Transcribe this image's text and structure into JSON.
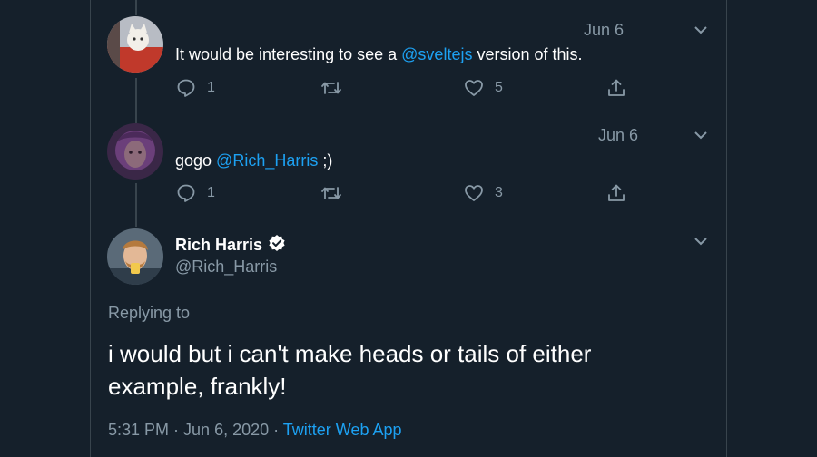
{
  "colors": {
    "background": "#15202b",
    "border": "#38444d",
    "secondary_text": "#8899a6",
    "link": "#1da1f2",
    "primary_text": "#ffffff"
  },
  "tweets": [
    {
      "date": "Jun 6",
      "text_before": "It would be interesting to see a ",
      "mention": "@sveltejs",
      "text_after": " version of this.",
      "reply_count": "1",
      "like_count": "5"
    },
    {
      "date": "Jun 6",
      "text_before": "gogo ",
      "mention": "@Rich_Harris",
      "text_after": " ;)",
      "reply_count": "1",
      "like_count": "3"
    }
  ],
  "main_tweet": {
    "name": "Rich Harris",
    "handle": "@Rich_Harris",
    "replying_to": "Replying to",
    "text": "i would but i can't make heads or tails of either example, frankly!",
    "time": "5:31 PM",
    "separator": " · ",
    "date": "Jun 6, 2020",
    "app": "Twitter Web App"
  },
  "icons": {
    "reply": "reply-icon",
    "retweet": "retweet-icon",
    "like": "heart-icon",
    "share": "share-icon",
    "more": "chevron-down-icon",
    "verified": "verified-badge-icon"
  }
}
